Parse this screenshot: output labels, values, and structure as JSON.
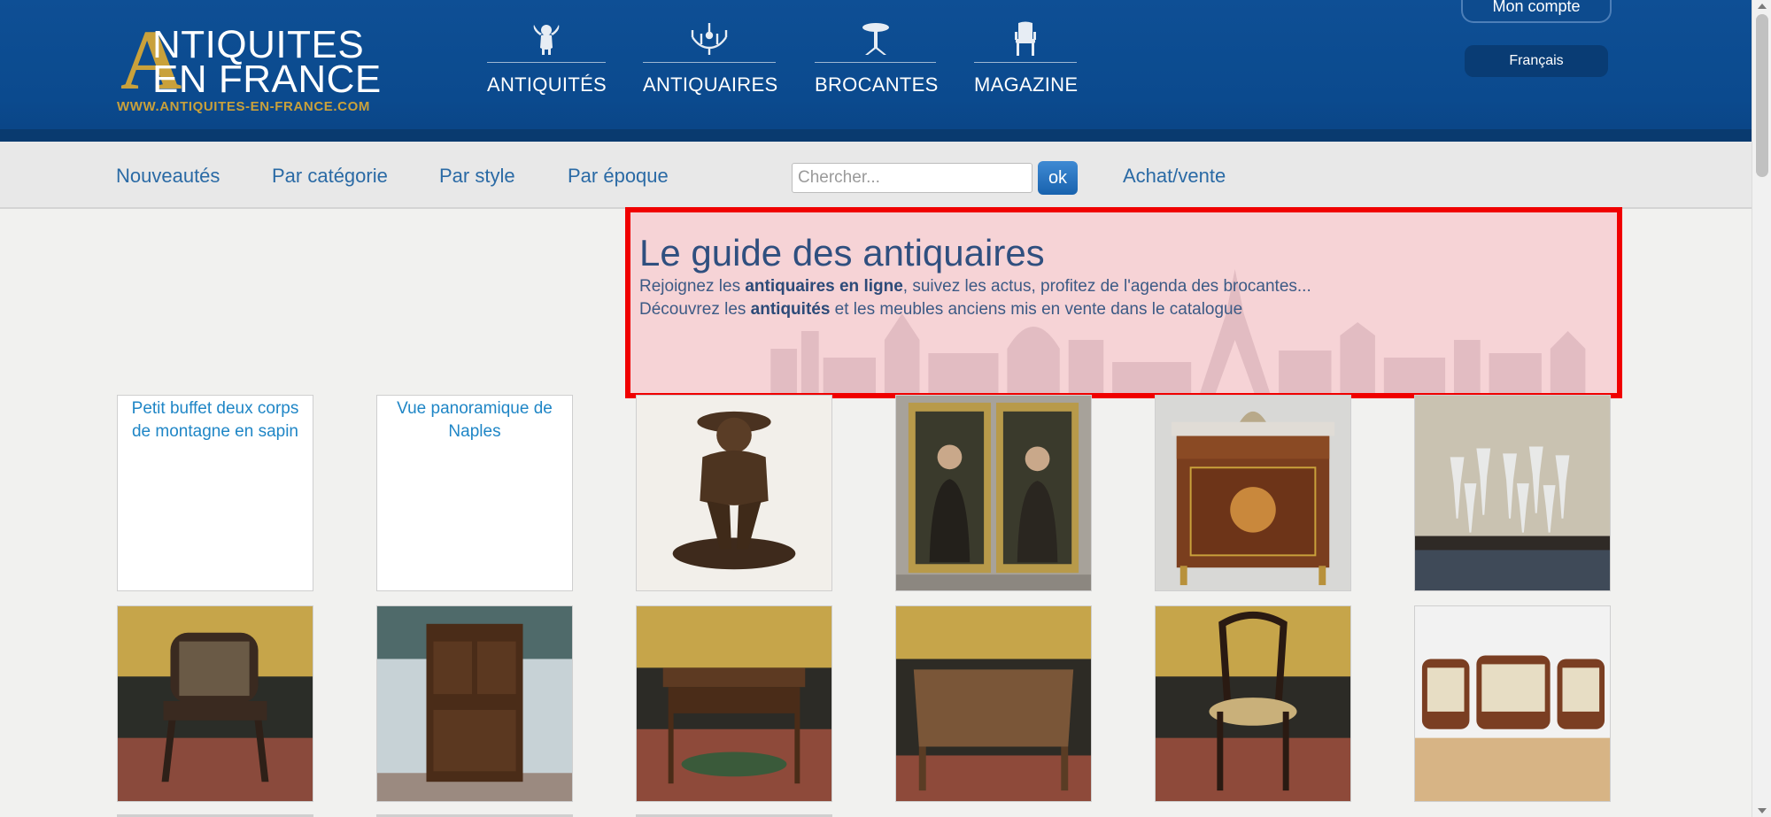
{
  "header": {
    "logo": {
      "big_letter": "A",
      "line1": "NTIQUITES",
      "line2": "EN FRANCE",
      "url": "WWW.ANTIQUITES-EN-FRANCE.COM"
    },
    "main_nav": [
      {
        "label": "ANTIQUITÉS",
        "icon": "cherub-icon"
      },
      {
        "label": "ANTIQUAIRES",
        "icon": "chandelier-icon"
      },
      {
        "label": "BROCANTES",
        "icon": "table-icon"
      },
      {
        "label": "MAGAZINE",
        "icon": "chair-icon"
      }
    ],
    "account_label": "Mon compte",
    "language_label": "Français"
  },
  "subnav": {
    "links": [
      "Nouveautés",
      "Par catégorie",
      "Par style",
      "Par époque"
    ],
    "search_placeholder": "Chercher...",
    "search_button": "ok",
    "achat_vente": "Achat/vente"
  },
  "hero": {
    "title": "Le guide des antiquaires",
    "line1_prefix": "Rejoignez les ",
    "line1_bold": "antiquaires en ligne",
    "line1_suffix": ", suivez les actus, profitez de l'agenda des brocantes...",
    "line2_prefix": "Découvrez les ",
    "line2_bold": "antiquités",
    "line2_suffix": " et les meubles anciens mis en vente dans le catalogue"
  },
  "grid": {
    "row1": [
      {
        "alt": "Petit buffet deux corps de montagne en sapin",
        "image": "broken"
      },
      {
        "alt": "Vue panoramique de Naples",
        "image": "broken"
      },
      {
        "alt": "",
        "image": "bronze-statue"
      },
      {
        "alt": "",
        "image": "pair-of-portraits"
      },
      {
        "alt": "",
        "image": "marquetry-commode"
      },
      {
        "alt": "",
        "image": "crystal-glasses"
      }
    ],
    "row2": [
      {
        "alt": "",
        "image": "carved-chair"
      },
      {
        "alt": "",
        "image": "two-door-cabinet"
      },
      {
        "alt": "",
        "image": "writing-table"
      },
      {
        "alt": "",
        "image": "square-table"
      },
      {
        "alt": "",
        "image": "bentwood-chair"
      },
      {
        "alt": "",
        "image": "sofa-and-armchairs"
      }
    ]
  }
}
